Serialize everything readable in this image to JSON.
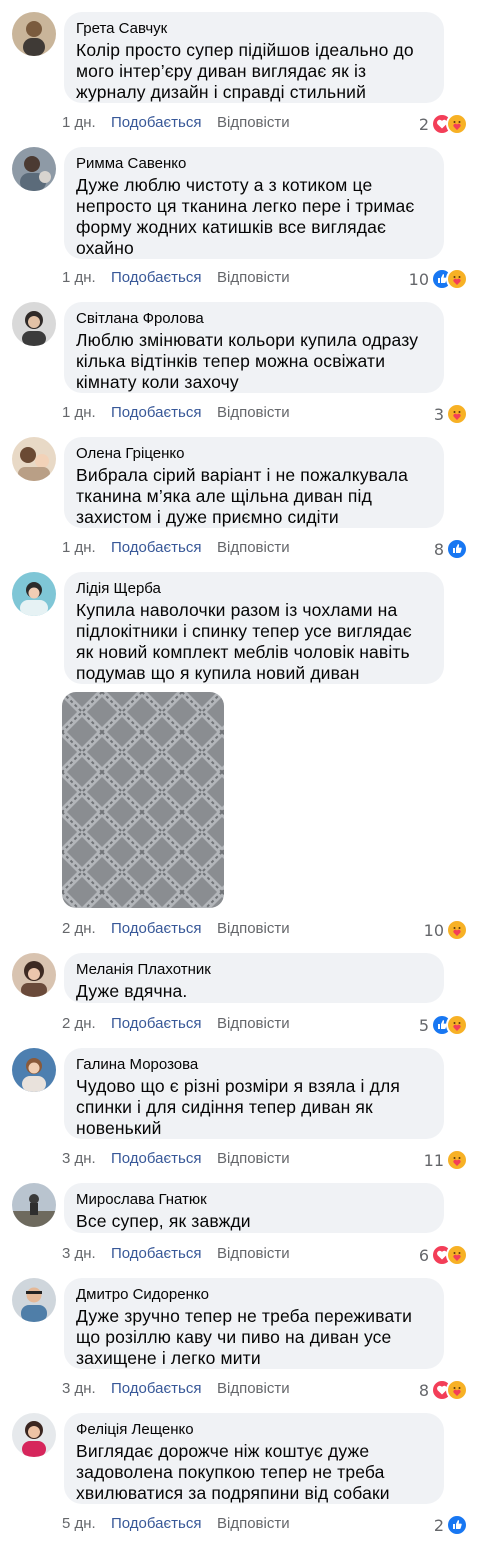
{
  "actions": {
    "like": "Подобається",
    "reply": "Відповісти"
  },
  "colors": {
    "like_link": "#385898",
    "bubble": "#f0f2f5",
    "meta": "#65676b",
    "like_reaction": "#1877f2",
    "love_reaction": "#f33e58",
    "care_reaction": "#f7b125"
  },
  "comments": [
    {
      "author": "Грета Савчук",
      "text": "Колір просто супер підійшов ідеально до мого інтер’єру диван виглядає як із журналу дизайн і справді стильний",
      "age": "1 дн.",
      "count": "2",
      "icons": [
        "heart",
        "care"
      ]
    },
    {
      "author": "Римма Савенко",
      "text": "Дуже люблю чистоту а з котиком це непросто ця тканина легко пере і тримає форму жодних катишків все виглядає охайно",
      "age": "1 дн.",
      "count": "10",
      "icons": [
        "like",
        "care"
      ]
    },
    {
      "author": "Світлана Фролова",
      "text": "Люблю змінювати кольори купила одразу кілька відтінків тепер можна освіжати кімнату коли захочу",
      "age": "1 дн.",
      "count": "3",
      "icons": [
        "care"
      ]
    },
    {
      "author": "Олена Гріценко",
      "text": "Вибрала сірий варіант і не пожалкувала тканина м’яка але щільна диван під захистом і дуже приємно сидіти",
      "age": "1 дн.",
      "count": "8",
      "icons": [
        "like"
      ]
    },
    {
      "author": "Лідія Щерба",
      "text": "Купила наволочки разом із чохлами на підлокітники і спинку тепер усе виглядає як новий комплект меблів чоловік навіть подумав що я купила новий диван",
      "age": "2 дн.",
      "count": "10",
      "icons": [
        "care"
      ],
      "has_image": true
    },
    {
      "author": "Меланія Плахотник",
      "text": "Дуже вдячна.",
      "age": "2 дн.",
      "count": "5",
      "icons": [
        "like",
        "care"
      ]
    },
    {
      "author": "Галина Морозова",
      "text": "Чудово що є різні розміри я взяла і для спинки і для сидіння тепер диван як новенький",
      "age": "3 дн.",
      "count": "11",
      "icons": [
        "care"
      ]
    },
    {
      "author": "Мирослава Гнатюк",
      "text": "Все супер, як завжди",
      "age": "3 дн.",
      "count": "6",
      "icons": [
        "heart",
        "care"
      ]
    },
    {
      "author": "Дмитро Сидоренко",
      "text": "Дуже зручно тепер не треба переживати що розіллю каву чи пиво на диван усе захищене і легко мити",
      "age": "3 дн.",
      "count": "8",
      "icons": [
        "heart",
        "care"
      ]
    },
    {
      "author": "Феліція Лещенко",
      "text": "Виглядає дорожче ніж коштує дуже задоволена покупкою тепер не треба хвилюватися за подряпини від собаки",
      "age": "5 дн.",
      "count": "2",
      "icons": [
        "like"
      ]
    }
  ]
}
